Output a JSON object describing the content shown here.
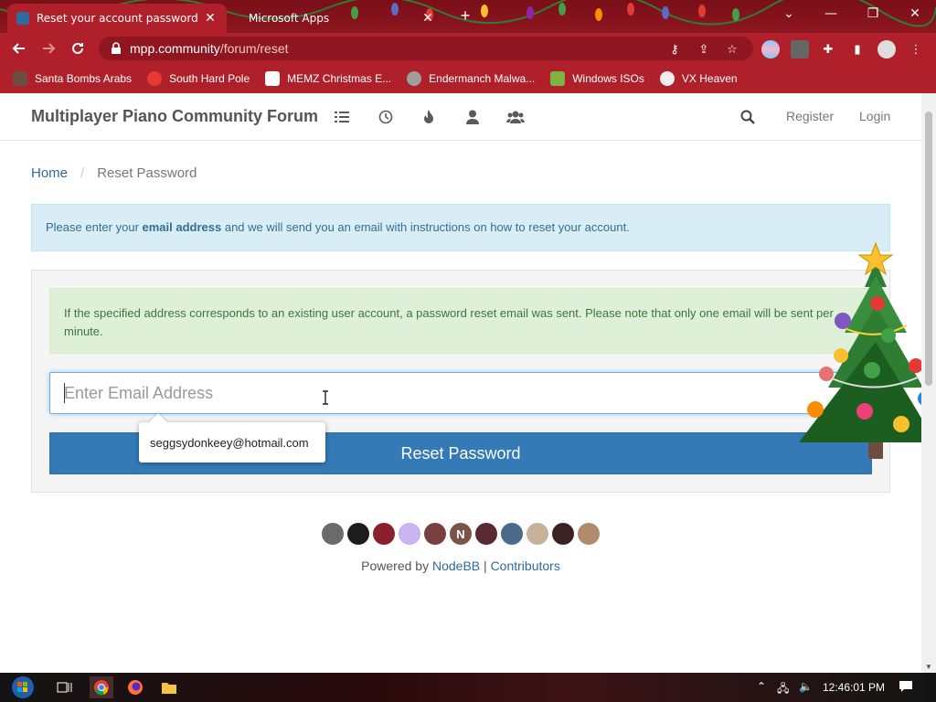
{
  "tabs": [
    {
      "title": "Reset your account password | m",
      "close": "✕",
      "active": true
    },
    {
      "title": "Microsoft Apps",
      "close": "✕",
      "active": false
    }
  ],
  "new_tab": "+",
  "window_controls": {
    "dropdown": "⌄",
    "minimize": "—",
    "restore": "❐",
    "close": "✕"
  },
  "address_bar": {
    "host": "mpp.community",
    "path": "/forum/reset"
  },
  "bookmarks": [
    {
      "label": "Santa Bombs Arabs",
      "icon": "figure-icon"
    },
    {
      "label": "South Hard Pole",
      "icon": "red-flower-icon"
    },
    {
      "label": "MEMZ Christmas E...",
      "icon": "page-icon"
    },
    {
      "label": "Endermanch Malwa...",
      "icon": "raccoon-icon"
    },
    {
      "label": "Windows ISOs",
      "icon": "elf-icon"
    },
    {
      "label": "VX Heaven",
      "icon": "vx-icon"
    }
  ],
  "forum": {
    "brand": "Multiplayer Piano Community Forum",
    "nav_icons": [
      "list-icon",
      "clock-icon",
      "fire-icon",
      "user-icon",
      "users-icon"
    ],
    "register": "Register",
    "login": "Login"
  },
  "breadcrumb": {
    "home": "Home",
    "sep": "/",
    "current": "Reset Password"
  },
  "info": {
    "before": "Please enter your ",
    "bold": "email address",
    "after": " and we will send you an email with instructions on how to reset your account."
  },
  "success_message": "If the specified address corresponds to an existing user account, a password reset email was sent. Please note that only one email will be sent per minute.",
  "email_input": {
    "placeholder": "Enter Email Address",
    "value": ""
  },
  "reset_button": "Reset Password",
  "autocomplete_suggestion": "seggsydonkeey@hotmail.com",
  "footer": {
    "avatars": [
      {
        "letter": "",
        "color": "#6b6b6b"
      },
      {
        "letter": "",
        "color": "#1c1c1c"
      },
      {
        "letter": "",
        "color": "#8c1f2c"
      },
      {
        "letter": "",
        "color": "#c9b3f0"
      },
      {
        "letter": "",
        "color": "#7a4040"
      },
      {
        "letter": "N",
        "color": "#795548"
      },
      {
        "letter": "",
        "color": "#5a2a32"
      },
      {
        "letter": "",
        "color": "#4a6a8a"
      },
      {
        "letter": "",
        "color": "#c7b299"
      },
      {
        "letter": "",
        "color": "#3a2222"
      },
      {
        "letter": "",
        "color": "#b08a6a"
      }
    ],
    "powered_by": "Powered by ",
    "nodebb": "NodeBB",
    "pipe": " | ",
    "contributors": "Contributors"
  },
  "taskbar": {
    "clock": "12:46:01 PM"
  },
  "colors": {
    "chrome": "#b0202b",
    "primary": "#337ab7",
    "info_bg": "#d9edf7",
    "success_bg": "#dff0d8"
  }
}
